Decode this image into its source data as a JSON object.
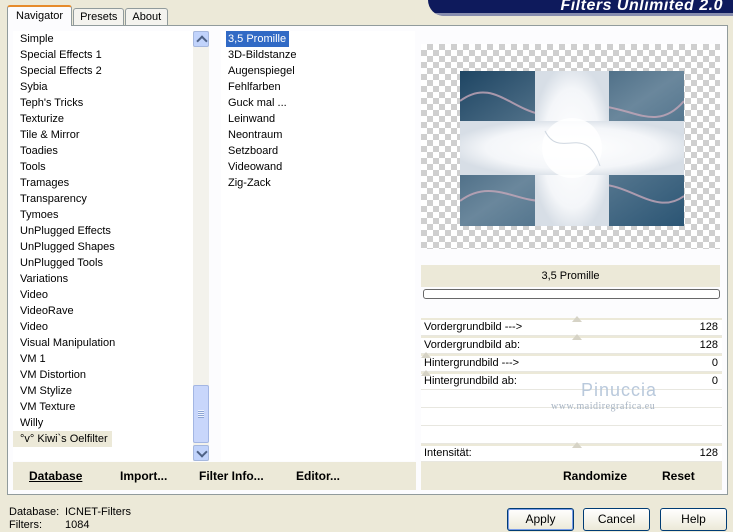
{
  "tabs": [
    {
      "label": "Navigator",
      "active": true
    },
    {
      "label": "Presets",
      "active": false
    },
    {
      "label": "About",
      "active": false
    }
  ],
  "banner": {
    "title": "Filters Unlimited 2.0"
  },
  "categories": [
    "Simple",
    "Special Effects 1",
    "Special Effects 2",
    "Sybia",
    "Teph's Tricks",
    "Texturize",
    "Tile & Mirror",
    "Toadies",
    "Tools",
    "Tramages",
    "Transparency",
    "Tymoes",
    "UnPlugged Effects",
    "UnPlugged Shapes",
    "UnPlugged Tools",
    "Variations",
    "Video",
    "VideoRave",
    "Video",
    "Visual Manipulation",
    "VM 1",
    "VM Distortion",
    "VM Stylize",
    "VM Texture",
    "Willy",
    "°v° Kiwi`s Oelfilter"
  ],
  "selected_category": "°v° Kiwi`s Oelfilter",
  "filters": [
    "3,5 Promille",
    "3D-Bildstanze",
    "Augenspiegel",
    "Fehlfarben",
    "Guck mal ...",
    "Leinwand",
    "Neontraum",
    "Setzboard",
    "Videowand",
    "Zig-Zack"
  ],
  "selected_filter": "3,5 Promille",
  "left_buttons": {
    "database": "Database",
    "import": "Import...",
    "filter_info": "Filter Info...",
    "editor": "Editor..."
  },
  "current_filter_name": "3,5 Promille",
  "params": [
    {
      "label": "Vordergrundbild --->",
      "value": "128"
    },
    {
      "label": "Vordergrundbild ab:",
      "value": "128"
    },
    {
      "label": "Hintergrundbild --->",
      "value": "0"
    },
    {
      "label": "Hintergrundbild ab:",
      "value": "0"
    },
    {
      "label": "",
      "value": ""
    },
    {
      "label": "",
      "value": ""
    },
    {
      "label": "",
      "value": ""
    },
    {
      "label": "Intensität:",
      "value": "128"
    }
  ],
  "right_buttons": {
    "randomize": "Randomize",
    "reset": "Reset"
  },
  "watermark": {
    "main": "Pinuccia",
    "sub": "www.maidiregrafica.eu"
  },
  "footer": {
    "database_label": "Database:",
    "database_value": "ICNET-Filters",
    "filters_label": "Filters:",
    "filters_value": "1084"
  },
  "dialog_buttons": {
    "apply": "Apply",
    "cancel": "Cancel",
    "help": "Help"
  },
  "colors": {
    "selection": "#316ac5",
    "banner": "#0e1a5c",
    "dialog_bg": "#ece9d8"
  }
}
